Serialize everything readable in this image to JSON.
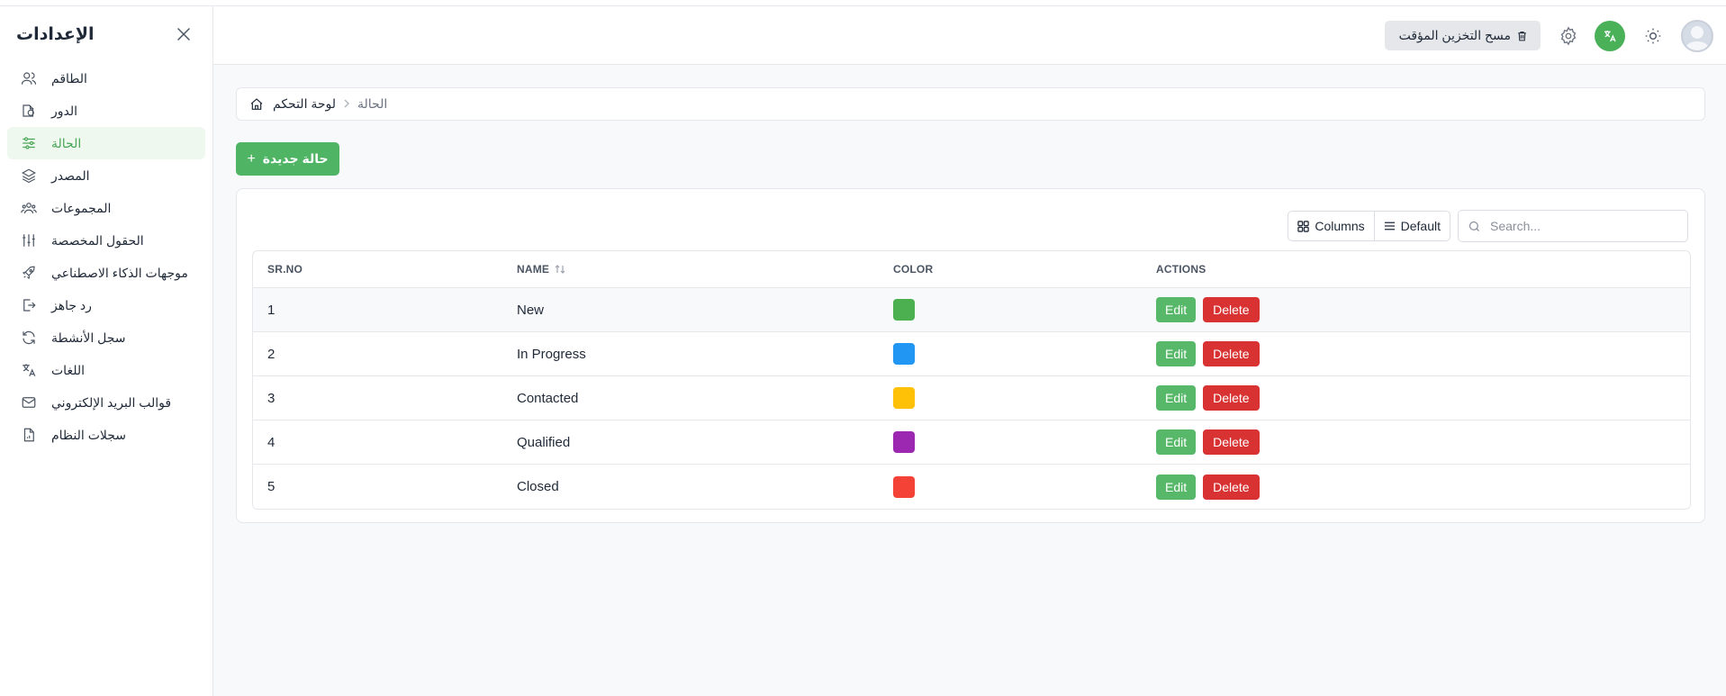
{
  "sidebar": {
    "title": "الإعدادات",
    "items": [
      {
        "label": "الطاقم",
        "icon": "users-icon"
      },
      {
        "label": "الدور",
        "icon": "role-icon"
      },
      {
        "label": "الحالة",
        "icon": "sliders-icon",
        "active": true
      },
      {
        "label": "المصدر",
        "icon": "layers-icon"
      },
      {
        "label": "المجموعات",
        "icon": "groups-icon"
      },
      {
        "label": "الحقول المخصصة",
        "icon": "custom-fields-icon"
      },
      {
        "label": "موجهات الذكاء الاصطناعي",
        "icon": "rocket-icon"
      },
      {
        "label": "رد جاهز",
        "icon": "reply-icon"
      },
      {
        "label": "سجل الأنشطة",
        "icon": "refresh-icon"
      },
      {
        "label": "اللغات",
        "icon": "translate-icon"
      },
      {
        "label": "قوالب البريد الإلكتروني",
        "icon": "mail-icon"
      },
      {
        "label": "سجلات النظام",
        "icon": "file-icon"
      }
    ]
  },
  "header": {
    "clear_cache_label": "مسح التخزين المؤقت"
  },
  "breadcrumb": {
    "home": "لوحة التحكم",
    "current": "الحالة"
  },
  "new_button_label": "حالة جديدة",
  "toolbar": {
    "columns_label": "Columns",
    "density_label": "Default",
    "search_placeholder": "Search..."
  },
  "table": {
    "columns": [
      "SR.NO",
      "NAME",
      "COLOR",
      "ACTIONS"
    ],
    "edit_label": "Edit",
    "delete_label": "Delete",
    "rows": [
      {
        "sr": "1",
        "name": "New",
        "color": "#4caf50"
      },
      {
        "sr": "2",
        "name": "In Progress",
        "color": "#2196f3"
      },
      {
        "sr": "3",
        "name": "Contacted",
        "color": "#ffc107"
      },
      {
        "sr": "4",
        "name": "Qualified",
        "color": "#9c27b0"
      },
      {
        "sr": "5",
        "name": "Closed",
        "color": "#f44336"
      }
    ]
  },
  "colors": {
    "accent": "#4fb463",
    "danger": "#d93232"
  }
}
